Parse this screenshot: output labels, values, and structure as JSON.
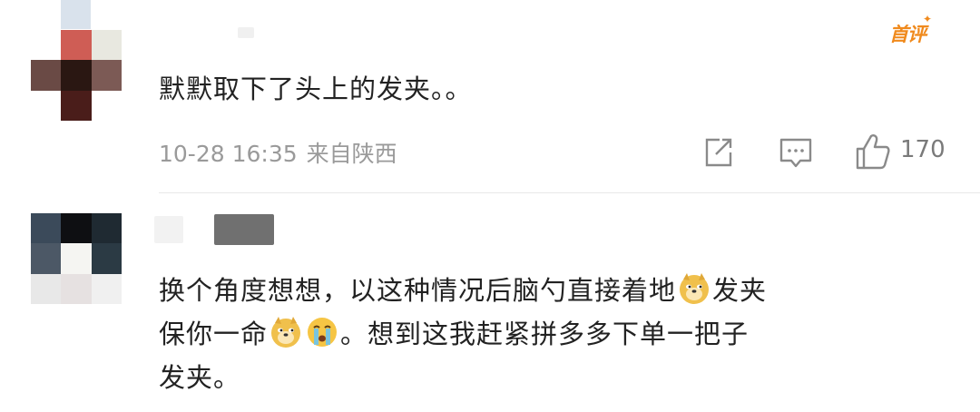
{
  "comments": [
    {
      "badge": "首评",
      "text": "默默取下了头上的发夹。。",
      "date": "10-28 16:35",
      "location": "来自陕西",
      "likes": "170",
      "icons": [
        "share-icon",
        "comment-icon",
        "like-icon"
      ]
    },
    {
      "text_line1": "换个角度想想，以这种情况后脑勺直接着地",
      "text_line1_tail": "发夹",
      "text_line2_a": "保你一命",
      "text_line2_b": "。想到这我赶紧拼多多下单一把子",
      "text_line3": "发夹。",
      "emojis": [
        "doge-emoji",
        "doge-emoji",
        "crying-emoji"
      ]
    }
  ],
  "colors": {
    "badge": "#f08a1d",
    "text": "#222222",
    "meta": "#9a9a9a",
    "icon": "#8a8a8a"
  }
}
